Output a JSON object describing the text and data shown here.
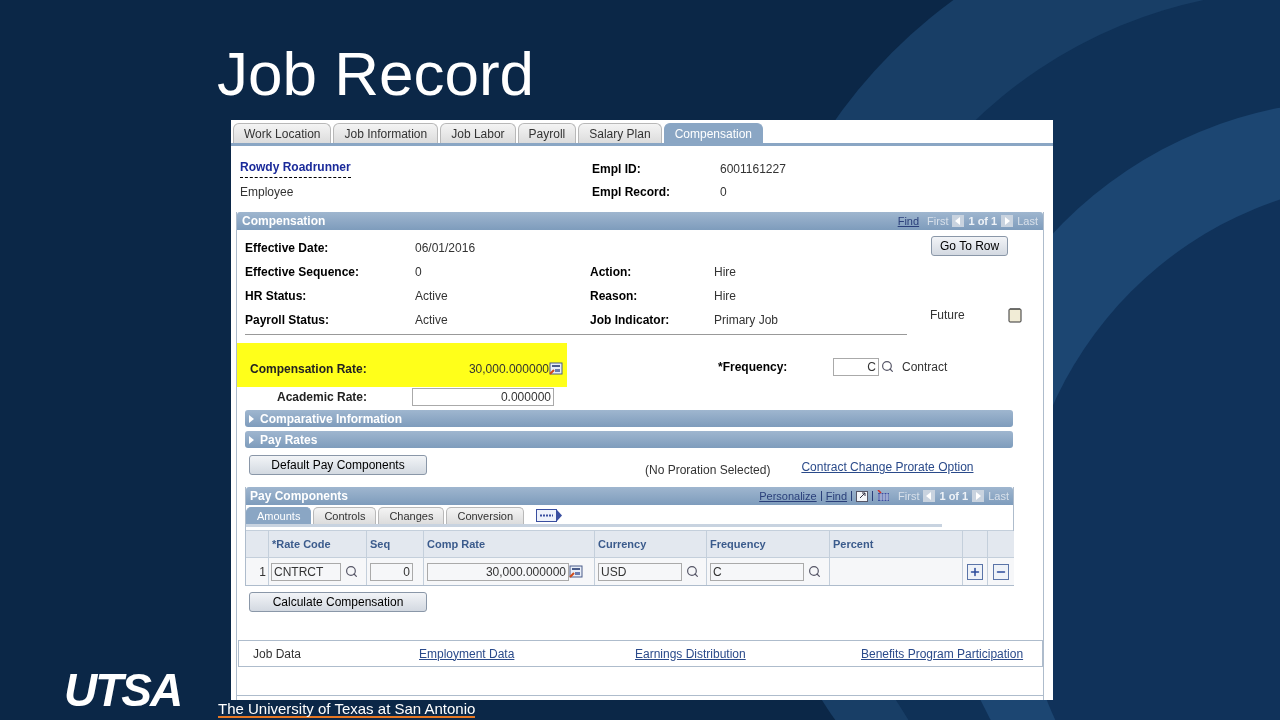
{
  "slide": {
    "title": "Job Record",
    "logo": {
      "wordmark": "UTSA",
      "subtitle": "The University of Texas at San Antonio"
    }
  },
  "tabs": [
    {
      "label": "Work Location",
      "selected": false
    },
    {
      "label": "Job Information",
      "selected": false
    },
    {
      "label": "Job Labor",
      "selected": false
    },
    {
      "label": "Payroll",
      "selected": false
    },
    {
      "label": "Salary Plan",
      "selected": false
    },
    {
      "label": "Compensation",
      "selected": true
    }
  ],
  "employee": {
    "name": "Rowdy Roadrunner",
    "type": "Employee",
    "fields": [
      {
        "label": "Empl ID:",
        "value": "6001161227"
      },
      {
        "label": "Empl Record:",
        "value": "0"
      }
    ]
  },
  "compensation": {
    "title": "Compensation",
    "nav": {
      "find": "Find",
      "first": "First",
      "count": "1 of 1",
      "last": "Last"
    },
    "go_to_row": "Go To Row",
    "rows": [
      [
        {
          "label": "Effective Date:",
          "value": "06/01/2016"
        }
      ],
      [
        {
          "label": "Effective Sequence:",
          "value": "0"
        },
        {
          "label": "Action:",
          "value": "Hire"
        }
      ],
      [
        {
          "label": "HR Status:",
          "value": "Active"
        },
        {
          "label": "Reason:",
          "value": "Hire"
        }
      ],
      [
        {
          "label": "Payroll Status:",
          "value": "Active"
        },
        {
          "label": "Job Indicator:",
          "value": "Primary Job"
        }
      ]
    ],
    "future": "Future",
    "comp_rate": {
      "label": "Compensation Rate:",
      "value": "30,000.000000",
      "highlighted": true
    },
    "academic_rate": {
      "label": "Academic Rate:",
      "value": "0.000000"
    },
    "frequency": {
      "label": "*Frequency:",
      "value": "C",
      "description": "Contract"
    },
    "collapsibles": [
      {
        "title": "Comparative Information",
        "expanded": false
      },
      {
        "title": "Pay Rates",
        "expanded": false
      }
    ],
    "default_button": "Default Pay Components",
    "proration": "(No Proration Selected)",
    "prorate_link": "Contract Change Prorate Option"
  },
  "pay_components": {
    "title": "Pay Components",
    "nav": {
      "personalize": "Personalize",
      "find": "Find",
      "first": "First",
      "count": "1 of 1",
      "last": "Last"
    },
    "tabs": [
      {
        "label": "Amounts",
        "selected": true
      },
      {
        "label": "Controls",
        "selected": false
      },
      {
        "label": "Changes",
        "selected": false
      },
      {
        "label": "Conversion",
        "selected": false
      }
    ],
    "columns": [
      "*Rate Code",
      "Seq",
      "Comp Rate",
      "Currency",
      "Frequency",
      "Percent"
    ],
    "rows": [
      {
        "number": "1",
        "rate_code": "CNTRCT",
        "seq": "0",
        "comp_rate": "30,000.000000",
        "currency": "USD",
        "frequency": "C"
      }
    ]
  },
  "calculate_button": "Calculate Compensation",
  "footer_links": [
    {
      "label": "Job Data",
      "link": false
    },
    {
      "label": "Employment Data",
      "link": true
    },
    {
      "label": "Earnings Distribution",
      "link": true
    },
    {
      "label": "Benefits Program Participation",
      "link": true
    }
  ]
}
